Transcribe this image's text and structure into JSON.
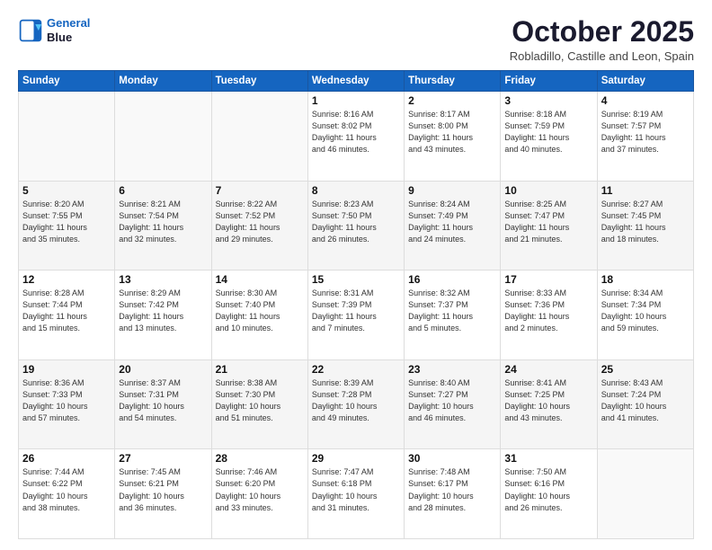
{
  "header": {
    "logo_line1": "General",
    "logo_line2": "Blue",
    "month": "October 2025",
    "location": "Robladillo, Castille and Leon, Spain"
  },
  "days_of_week": [
    "Sunday",
    "Monday",
    "Tuesday",
    "Wednesday",
    "Thursday",
    "Friday",
    "Saturday"
  ],
  "weeks": [
    [
      {
        "num": "",
        "info": ""
      },
      {
        "num": "",
        "info": ""
      },
      {
        "num": "",
        "info": ""
      },
      {
        "num": "1",
        "info": "Sunrise: 8:16 AM\nSunset: 8:02 PM\nDaylight: 11 hours\nand 46 minutes."
      },
      {
        "num": "2",
        "info": "Sunrise: 8:17 AM\nSunset: 8:00 PM\nDaylight: 11 hours\nand 43 minutes."
      },
      {
        "num": "3",
        "info": "Sunrise: 8:18 AM\nSunset: 7:59 PM\nDaylight: 11 hours\nand 40 minutes."
      },
      {
        "num": "4",
        "info": "Sunrise: 8:19 AM\nSunset: 7:57 PM\nDaylight: 11 hours\nand 37 minutes."
      }
    ],
    [
      {
        "num": "5",
        "info": "Sunrise: 8:20 AM\nSunset: 7:55 PM\nDaylight: 11 hours\nand 35 minutes."
      },
      {
        "num": "6",
        "info": "Sunrise: 8:21 AM\nSunset: 7:54 PM\nDaylight: 11 hours\nand 32 minutes."
      },
      {
        "num": "7",
        "info": "Sunrise: 8:22 AM\nSunset: 7:52 PM\nDaylight: 11 hours\nand 29 minutes."
      },
      {
        "num": "8",
        "info": "Sunrise: 8:23 AM\nSunset: 7:50 PM\nDaylight: 11 hours\nand 26 minutes."
      },
      {
        "num": "9",
        "info": "Sunrise: 8:24 AM\nSunset: 7:49 PM\nDaylight: 11 hours\nand 24 minutes."
      },
      {
        "num": "10",
        "info": "Sunrise: 8:25 AM\nSunset: 7:47 PM\nDaylight: 11 hours\nand 21 minutes."
      },
      {
        "num": "11",
        "info": "Sunrise: 8:27 AM\nSunset: 7:45 PM\nDaylight: 11 hours\nand 18 minutes."
      }
    ],
    [
      {
        "num": "12",
        "info": "Sunrise: 8:28 AM\nSunset: 7:44 PM\nDaylight: 11 hours\nand 15 minutes."
      },
      {
        "num": "13",
        "info": "Sunrise: 8:29 AM\nSunset: 7:42 PM\nDaylight: 11 hours\nand 13 minutes."
      },
      {
        "num": "14",
        "info": "Sunrise: 8:30 AM\nSunset: 7:40 PM\nDaylight: 11 hours\nand 10 minutes."
      },
      {
        "num": "15",
        "info": "Sunrise: 8:31 AM\nSunset: 7:39 PM\nDaylight: 11 hours\nand 7 minutes."
      },
      {
        "num": "16",
        "info": "Sunrise: 8:32 AM\nSunset: 7:37 PM\nDaylight: 11 hours\nand 5 minutes."
      },
      {
        "num": "17",
        "info": "Sunrise: 8:33 AM\nSunset: 7:36 PM\nDaylight: 11 hours\nand 2 minutes."
      },
      {
        "num": "18",
        "info": "Sunrise: 8:34 AM\nSunset: 7:34 PM\nDaylight: 10 hours\nand 59 minutes."
      }
    ],
    [
      {
        "num": "19",
        "info": "Sunrise: 8:36 AM\nSunset: 7:33 PM\nDaylight: 10 hours\nand 57 minutes."
      },
      {
        "num": "20",
        "info": "Sunrise: 8:37 AM\nSunset: 7:31 PM\nDaylight: 10 hours\nand 54 minutes."
      },
      {
        "num": "21",
        "info": "Sunrise: 8:38 AM\nSunset: 7:30 PM\nDaylight: 10 hours\nand 51 minutes."
      },
      {
        "num": "22",
        "info": "Sunrise: 8:39 AM\nSunset: 7:28 PM\nDaylight: 10 hours\nand 49 minutes."
      },
      {
        "num": "23",
        "info": "Sunrise: 8:40 AM\nSunset: 7:27 PM\nDaylight: 10 hours\nand 46 minutes."
      },
      {
        "num": "24",
        "info": "Sunrise: 8:41 AM\nSunset: 7:25 PM\nDaylight: 10 hours\nand 43 minutes."
      },
      {
        "num": "25",
        "info": "Sunrise: 8:43 AM\nSunset: 7:24 PM\nDaylight: 10 hours\nand 41 minutes."
      }
    ],
    [
      {
        "num": "26",
        "info": "Sunrise: 7:44 AM\nSunset: 6:22 PM\nDaylight: 10 hours\nand 38 minutes."
      },
      {
        "num": "27",
        "info": "Sunrise: 7:45 AM\nSunset: 6:21 PM\nDaylight: 10 hours\nand 36 minutes."
      },
      {
        "num": "28",
        "info": "Sunrise: 7:46 AM\nSunset: 6:20 PM\nDaylight: 10 hours\nand 33 minutes."
      },
      {
        "num": "29",
        "info": "Sunrise: 7:47 AM\nSunset: 6:18 PM\nDaylight: 10 hours\nand 31 minutes."
      },
      {
        "num": "30",
        "info": "Sunrise: 7:48 AM\nSunset: 6:17 PM\nDaylight: 10 hours\nand 28 minutes."
      },
      {
        "num": "31",
        "info": "Sunrise: 7:50 AM\nSunset: 6:16 PM\nDaylight: 10 hours\nand 26 minutes."
      },
      {
        "num": "",
        "info": ""
      }
    ]
  ]
}
